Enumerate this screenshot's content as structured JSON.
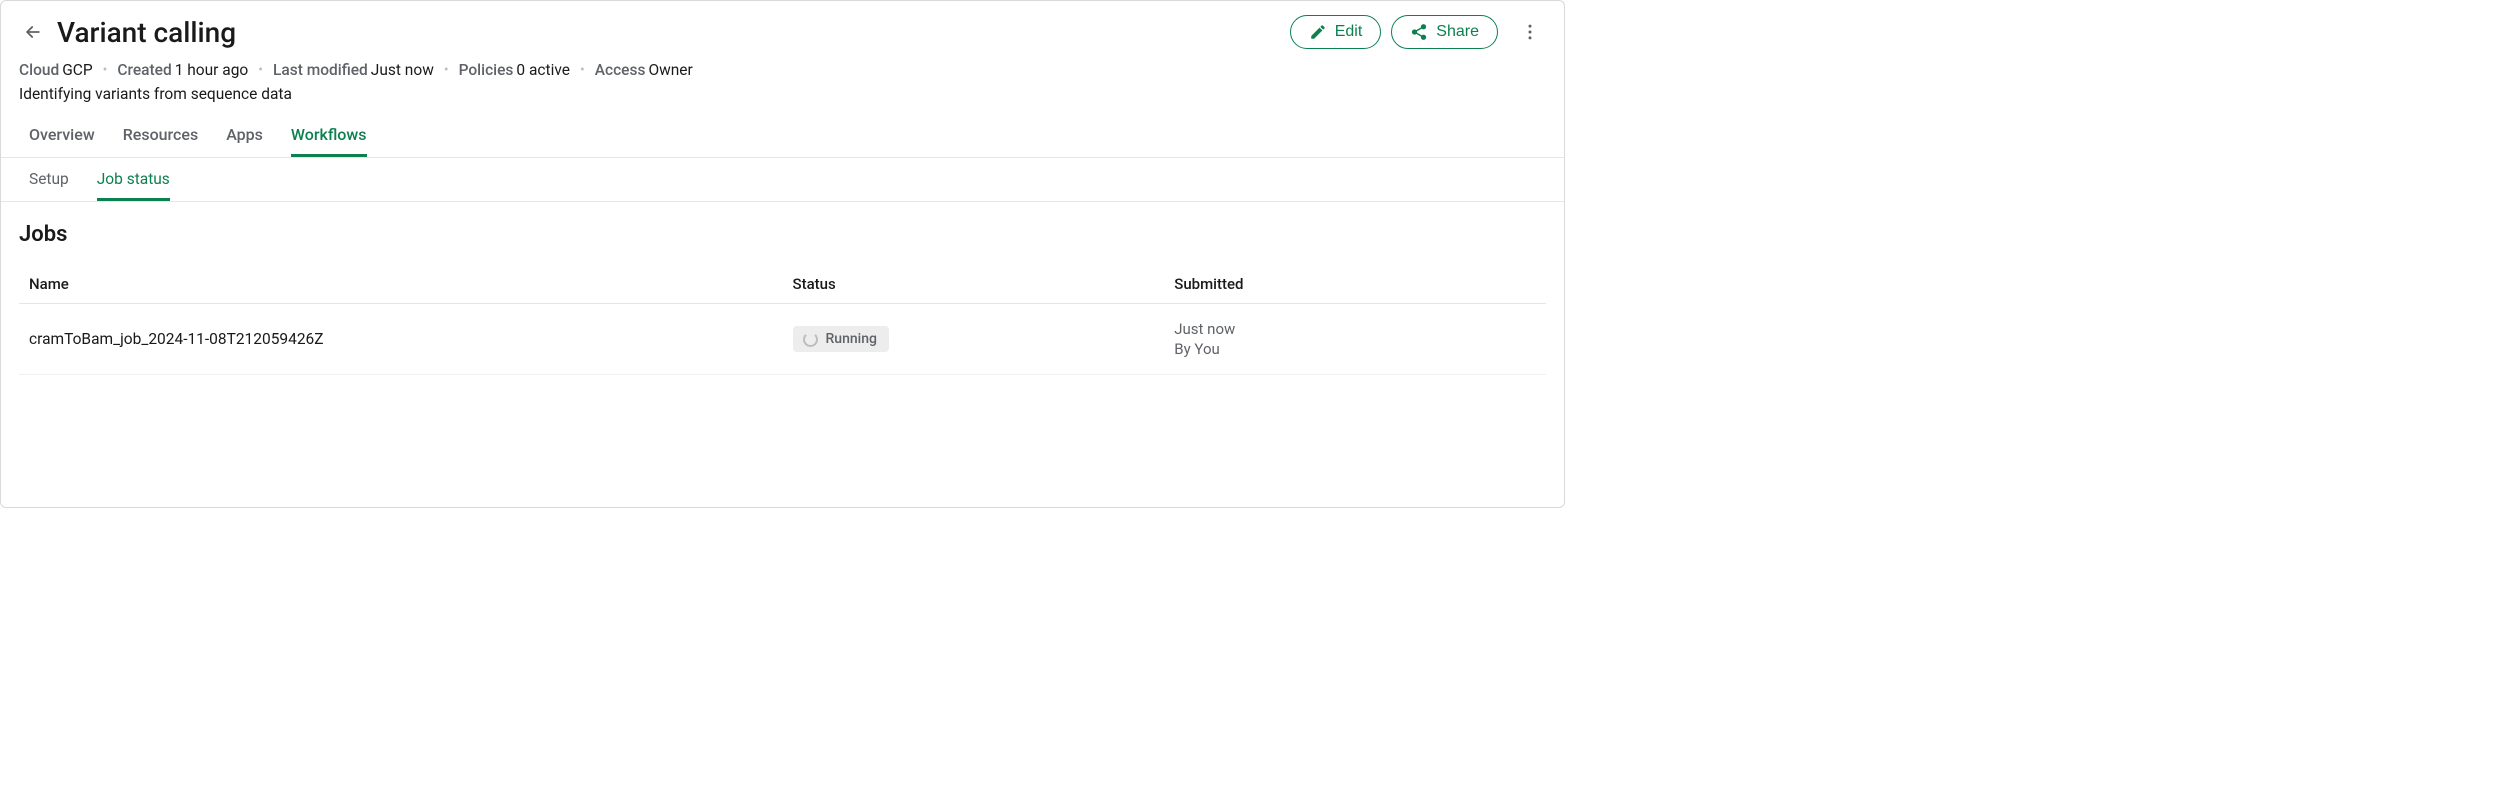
{
  "header": {
    "title": "Variant calling",
    "edit_label": "Edit",
    "share_label": "Share"
  },
  "meta": {
    "cloud_label": "Cloud",
    "cloud_value": "GCP",
    "created_label": "Created",
    "created_value": "1 hour ago",
    "modified_label": "Last modified",
    "modified_value": "Just now",
    "policies_label": "Policies",
    "policies_value": "0 active",
    "access_label": "Access",
    "access_value": "Owner"
  },
  "description": "Identifying variants from sequence data",
  "tabs_primary": {
    "overview": "Overview",
    "resources": "Resources",
    "apps": "Apps",
    "workflows": "Workflows"
  },
  "tabs_secondary": {
    "setup": "Setup",
    "job_status": "Job status"
  },
  "jobs": {
    "section_title": "Jobs",
    "columns": {
      "name": "Name",
      "status": "Status",
      "submitted": "Submitted"
    },
    "rows": [
      {
        "name": "cramToBam_job_2024-11-08T212059426Z",
        "status": "Running",
        "submitted_time": "Just now",
        "submitted_by": "By You"
      }
    ]
  }
}
